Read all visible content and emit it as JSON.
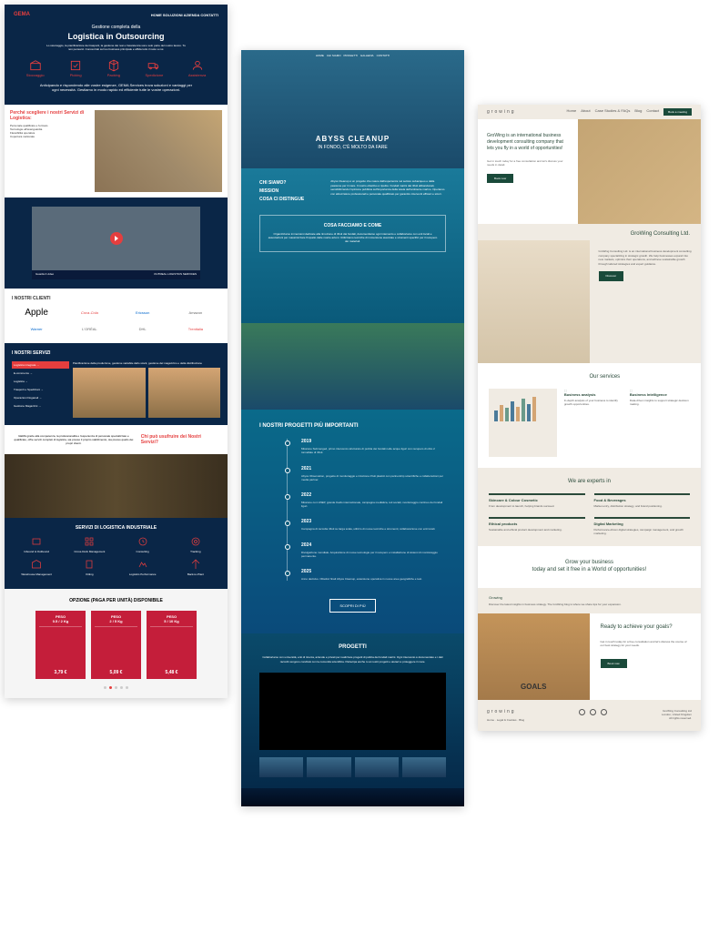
{
  "gema": {
    "brand": "GEMA",
    "nav": "HOME  SOLUZIONI  AZIENDA  CONTATTI",
    "hero_sub": "Gestione completa della",
    "hero_title": "Logistica in Outsourcing",
    "hero_desc": "Lo stoccaggio, la pianificazione dei trasporti, la gestione dei resi e l'assistenza sono solo parte del nostro lavoro. Tu non pensarci. Concentrati sul tuo business principale e affida tutto il resto a noi.",
    "icons": [
      {
        "label": "Stoccaggio"
      },
      {
        "label": "Picking"
      },
      {
        "label": "Packing"
      },
      {
        "label": "Spedizione"
      },
      {
        "label": "Assistenza"
      }
    ],
    "hero2": "Anticipando e rispondendo alle vostre esigenze, GEMA Services trova soluzioni e vantaggi per ogni necessità. Gestiamo in modo rapido ed efficiente tutte le vostre operazioni.",
    "why_title": "Perché scegliere i nostri Servizi di Logistica:",
    "why_items": "Personale qualificato e formato\nTecnologie all'avanguardia\nFlessibilità operativa\nCopertura nazionale",
    "video_bar_l": "Guarda il video",
    "video_bar_r": "OUTREAL LOGISTICS SERVICES",
    "clients_title": "I NOSTRI CLIENTI",
    "clients": [
      "Apple",
      "Coca-Cola",
      "Ericsson",
      "Amazon",
      "Warner",
      "L'ORÉAL",
      "DHL",
      "Trenitalia"
    ],
    "serv_title": "I NOSTRI SERVIZI",
    "serv_menu": [
      "Logistica integrata →",
      "E-commerce →",
      "Logistica →",
      "Trasporti e Spedizioni →",
      "Operazioni Doganali →",
      "Gestione Magazzini →"
    ],
    "serv_desc": "Pianificazione della produzione, gestione variabile dello stock, gestione del magazzino e della distribuzione",
    "team_desc": "GEMA grazie alla competenza, la professionalità e l'esperienza di personale specializzato e qualificato, offre servizi completi di logistica, sia presso il proprio stabilimento, sia presso quello dei propri clienti.",
    "team_title": "Chi può usufruire dei Nostri Servizi?",
    "ind_title": "SERVIZI DI LOGISTICA INDUSTRIALE",
    "ind_items": [
      "Inbound & Outbound",
      "Cross-Dock Management",
      "Consulting",
      "Tracking",
      "Warehouse Management",
      "Kitting",
      "Logistics Performance",
      "Back-to-Plant"
    ],
    "price_title": "OPZIONE (PAGA PER UNITÀ) DISPONIBILE",
    "prices": [
      {
        "label": "PESO",
        "weight": "0.5 / 2 Kg",
        "p": "3,79 €"
      },
      {
        "label": "PESO",
        "weight": "2 / 5 Kg",
        "p": "5,09 €"
      },
      {
        "label": "PESO",
        "weight": "5 / 10 Kg",
        "p": "5,48 €"
      }
    ]
  },
  "abyss": {
    "nav": [
      "HOME",
      "CHI SIAMO",
      "PROGETTI",
      "GALLERIA",
      "CONTATTI"
    ],
    "hero_t": "ABYSS CLEANUP",
    "hero_s": "IN FONDO, C'È MOLTO DA FARE",
    "about_l": [
      "CHI SIAMO?",
      "MISSION",
      "COSA CI DISTINGUE"
    ],
    "about_r": "Abyss Cleanup è un progetto che nasce dall'esperienza nel settore subacqueo e dalla passione per il mare. Il nostro obiettivo è ripulire i fondali marini dai rifiuti abbandonati, sensibilizzando l'opinione pubblica sull'importanza della tutela dell'ambiente marino. Operiamo con attrezzature professionali e personale qualificato per garantire interventi efficaci e sicuri.",
    "box_t": "COSA FACCIAMO E COME",
    "box_d": "Organizziamo immersioni dedicate alla rimozione di rifiuti dai fondali, documentiamo ogni intervento e collaboriamo con enti locali e associazioni per massimizzare l'impatto delle nostre azioni. Utilizziamo tecniche di immersione avanzate e strumenti specifici per il recupero dei materiali.",
    "proj_t": "I NOSTRI PROGETTI PIÙ IMPORTANTI",
    "timeline": [
      {
        "y": "2019",
        "d": "Missione Submerged, primo intervento strutturato di pulizia dei fondali nelle acque liguri con recupero di oltre 2 tonnellate di rifiuti."
      },
      {
        "y": "2021",
        "d": "Abyss Observation, progetto di monitoraggio e riduzione rifiuti plastici con partnership scientifiche e collaborazioni per media partner."
      },
      {
        "y": "2022",
        "d": "Missione con UNEP, grande livello internazionale, campagna mediática, reti sociali, monitoraggio continuo dei fondali liguri."
      },
      {
        "y": "2023",
        "d": "Campagna di raccolta rifiuti su larga scala, utilizzo di nuove tecniche e strumenti, collaborazione con enti locali."
      },
      {
        "y": "2024",
        "d": "Divulgazione mondiale. Acquisizione di nuove tecnologie per il recupero e installazione di sistemi di monitoraggio permanente."
      },
      {
        "y": "2025",
        "d": "Anno decisivo. Obiettivi finali Abyss Cleanup, estensione operativa in nuove aree geografiche e test."
      }
    ],
    "btn": "SCOPRI DI PIÙ",
    "prog_t": "PROGETTI",
    "prog_d": "Collaboriamo con università, enti di ricerca, aziende e privati per realizzare progetti di pulizia dei fondali marini. Ogni intervento è documentato e i dati raccolti vengono condivisi con la comunità scientifica. Partecipa anche tu ai nostri progetti e aiutaci a proteggere il mare."
  },
  "growing": {
    "brand": "growing",
    "nav": [
      "Home",
      "About",
      "Case Studies & FAQs",
      "Blog",
      "Contact"
    ],
    "nav_btn": "Book a meeting",
    "hero_t": "GroWing is an international business development consulting company that lets you fly in a world of opportunities!",
    "hero_d": "Get in touch today for a free consultation and let's discuss your needs in detail.",
    "hero_b": "Book now",
    "about_t": "GroWing Consulting Ltd.",
    "about_d": "GroWing Consulting Ltd. is an international business development consulting company specializing in strategic growth. We help businesses expand into new markets, optimize their operations, and achieve sustainable growth through tailored strategies and expert guidance.",
    "about_b": "Discover",
    "serv_t": "Our services",
    "services": [
      {
        "t": "Business analysis",
        "d": "In-depth analysis of your business to identify growth opportunities."
      },
      {
        "t": "Business Intelligence",
        "d": "Data-driven insights to support strategic decision making."
      }
    ],
    "exp_t": "We are experts in",
    "experts": [
      {
        "t": "Skincare & Colour Cosmetic",
        "d": "From development to launch, helping brands succeed."
      },
      {
        "t": "Food & Beverages",
        "d": "Market entry, distribution strategy, and brand positioning."
      },
      {
        "t": "Ethical products",
        "d": "Sustainable and ethical product development and marketing."
      },
      {
        "t": "Digital Marketing",
        "d": "Performance-driven digital strategies, campaign management, and growth marketing."
      }
    ],
    "cta_t1": "Grow your business",
    "cta_t2": "today and set it free in a World of opportunities!",
    "grow_t": "Growing",
    "grow_d": "Discover the latest insights in business strategy. The GroWing blog is where we share tips for your expansion.",
    "goals_img": "GOALS",
    "goals_t": "Ready to achieve your goals?",
    "goals_d": "Get in touch today for a free consultation and let's discuss the course of our best strategy for your needs.",
    "goals_b": "Book now",
    "foot_links": [
      "Home",
      "Legal & Cookies",
      "Blog"
    ],
    "foot_r": "GroWing Consulting Ltd\nLondon, United Kingdom\nAll rights reserved."
  }
}
